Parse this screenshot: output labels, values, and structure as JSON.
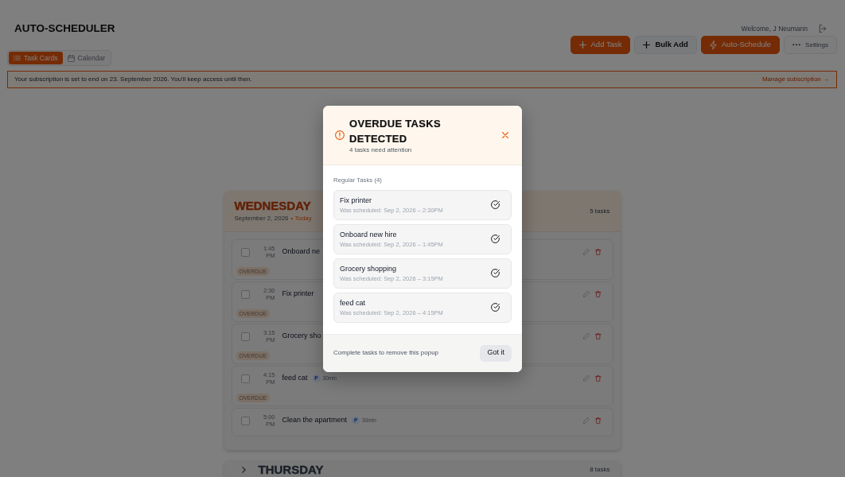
{
  "header": {
    "title": "AUTO-SCHEDULER",
    "welcome": "Welcome, J Neumann"
  },
  "actions": [
    {
      "label": "Add Task"
    },
    {
      "label": "Bulk Add"
    },
    {
      "label": "Auto-Schedule"
    },
    {
      "label": "Settings"
    }
  ],
  "view_tabs": [
    {
      "label": "Task Cards",
      "selected": true
    },
    {
      "label": "Calendar",
      "selected": false
    }
  ],
  "subscription_banner": {
    "message": "Your subscription is set to end on 23. September 2026. You'll keep access until then.",
    "link": "Manage subscription →"
  },
  "days": [
    {
      "name": "WEDNESDAY",
      "date": "September 2, 2026",
      "today_label": "• Today",
      "count": "5 tasks",
      "today": true,
      "expanded": true,
      "tasks": [
        {
          "time": "1:45 PM",
          "title": "Onboard ne",
          "checked": false,
          "overdue_label": "OVERDUE"
        },
        {
          "time": "2:30 PM",
          "title": "Fix printer",
          "checked": false,
          "overdue_label": "OVERDUE"
        },
        {
          "time": "3:15 PM",
          "title": "Grocery sho",
          "checked": false,
          "overdue_label": "OVERDUE"
        },
        {
          "time": "4:15 PM",
          "title": "feed cat",
          "priority": "P",
          "duration": "30min",
          "checked": false,
          "overdue_label": "OVERDUE"
        },
        {
          "time": "5:00 PM",
          "title": "Clean the apartment",
          "priority": "P",
          "duration": "30min",
          "checked": false
        }
      ]
    },
    {
      "name": "THURSDAY",
      "count": "8 tasks",
      "today": false,
      "expanded": false
    }
  ],
  "overdue_dialog": {
    "title": "OVERDUE TASKS DETECTED",
    "subtitle": "4 tasks need attention",
    "section": "Regular Tasks (4)",
    "tasks": [
      {
        "title": "Fix printer",
        "scheduled": "Was scheduled: Sep 2, 2026 – 2:30PM"
      },
      {
        "title": "Onboard new hire",
        "scheduled": "Was scheduled: Sep 2, 2026 – 1:45PM"
      },
      {
        "title": "Grocery shopping",
        "scheduled": "Was scheduled: Sep 2, 2026 – 3:15PM"
      },
      {
        "title": "feed cat",
        "scheduled": "Was scheduled: Sep 2, 2026 – 4:15PM"
      }
    ],
    "note": "Complete tasks to remove this popup",
    "button": "Got it"
  }
}
